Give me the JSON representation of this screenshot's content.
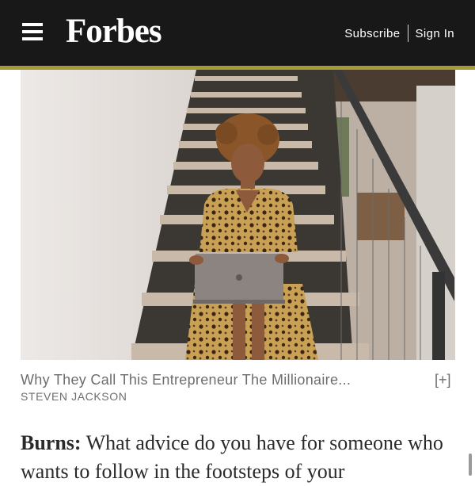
{
  "header": {
    "brand": "Forbes",
    "subscribe_label": "Subscribe",
    "signin_label": "Sign In",
    "background_color": "#181818",
    "accent_rule_color": "#a59a35"
  },
  "hero": {
    "caption": "Why They Call This Entrepreneur The Millionaire...",
    "expand_label": "[+]",
    "credit": "STEVEN JACKSON"
  },
  "article": {
    "speaker": "Burns:",
    "question": "What advice do you have for someone who wants to follow in the footsteps of your"
  }
}
